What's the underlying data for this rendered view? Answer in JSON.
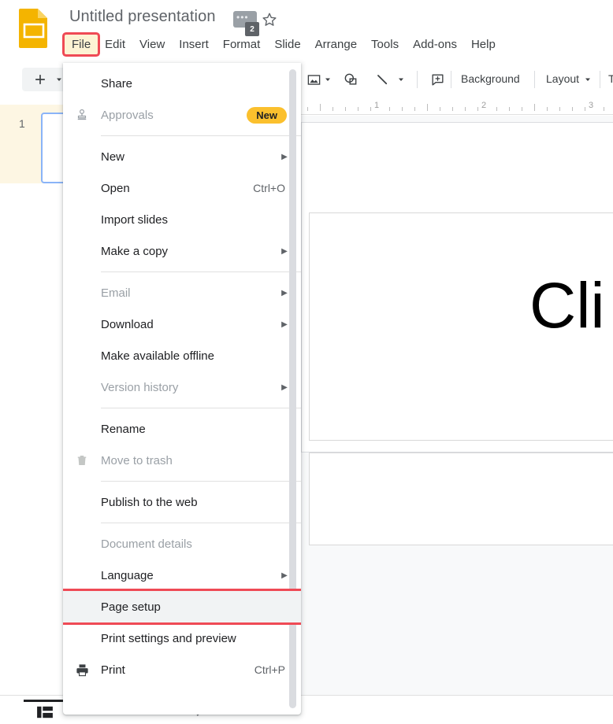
{
  "app": {
    "logo_icon": "google-slides-logo",
    "doc_title": "Untitled presentation",
    "title_chip_dots": "•••",
    "title_badge": "2",
    "star_icon": "star-outline-icon"
  },
  "menubar": {
    "items": [
      {
        "label": "File",
        "active": true
      },
      {
        "label": "Edit",
        "active": false
      },
      {
        "label": "View",
        "active": false
      },
      {
        "label": "Insert",
        "active": false
      },
      {
        "label": "Format",
        "active": false
      },
      {
        "label": "Slide",
        "active": false
      },
      {
        "label": "Arrange",
        "active": false
      },
      {
        "label": "Tools",
        "active": false
      },
      {
        "label": "Add-ons",
        "active": false
      },
      {
        "label": "Help",
        "active": false
      }
    ]
  },
  "toolbar": {
    "new_slide_icon": "plus-icon",
    "new_slide_caret_icon": "chevron-down-icon",
    "image_icon": "image-icon",
    "image_caret_icon": "chevron-down-icon",
    "shape_icon": "shape-icon",
    "line_icon": "line-icon",
    "line_caret_icon": "chevron-down-icon",
    "comment_icon": "add-comment-icon",
    "background_label": "Background",
    "layout_label": "Layout",
    "layout_caret_icon": "chevron-down-icon",
    "theme_label": "T"
  },
  "ruler": {
    "numbers": [
      "1",
      "2",
      "3"
    ]
  },
  "filmstrip": {
    "slide_number": "1"
  },
  "canvas": {
    "title_placeholder_text": "Cli",
    "title_placeholder_name": "title-placeholder",
    "subtitle_placeholder_name": "subtitle-placeholder"
  },
  "bottombar": {
    "layout_icon": "layout-view-icon",
    "grid_icon": "grid-view-icon",
    "pen_icon": "pen-icon"
  },
  "file_menu": {
    "scrollbar_name": "menu-scrollbar",
    "items": [
      {
        "type": "item",
        "label": "Share",
        "icon": "",
        "accel": "",
        "arrow": false,
        "disabled": false,
        "badge": "",
        "highlight": false
      },
      {
        "type": "item",
        "label": "Approvals",
        "icon": "stamp-icon",
        "accel": "",
        "arrow": false,
        "disabled": true,
        "badge": "New",
        "highlight": false
      },
      {
        "type": "sep"
      },
      {
        "type": "item",
        "label": "New",
        "icon": "",
        "accel": "",
        "arrow": true,
        "disabled": false,
        "badge": "",
        "highlight": false
      },
      {
        "type": "item",
        "label": "Open",
        "icon": "",
        "accel": "Ctrl+O",
        "arrow": false,
        "disabled": false,
        "badge": "",
        "highlight": false
      },
      {
        "type": "item",
        "label": "Import slides",
        "icon": "",
        "accel": "",
        "arrow": false,
        "disabled": false,
        "badge": "",
        "highlight": false
      },
      {
        "type": "item",
        "label": "Make a copy",
        "icon": "",
        "accel": "",
        "arrow": true,
        "disabled": false,
        "badge": "",
        "highlight": false
      },
      {
        "type": "sep"
      },
      {
        "type": "item",
        "label": "Email",
        "icon": "",
        "accel": "",
        "arrow": true,
        "disabled": true,
        "badge": "",
        "highlight": false
      },
      {
        "type": "item",
        "label": "Download",
        "icon": "",
        "accel": "",
        "arrow": true,
        "disabled": false,
        "badge": "",
        "highlight": false
      },
      {
        "type": "item",
        "label": "Make available offline",
        "icon": "",
        "accel": "",
        "arrow": false,
        "disabled": false,
        "badge": "",
        "highlight": false
      },
      {
        "type": "item",
        "label": "Version history",
        "icon": "",
        "accel": "",
        "arrow": true,
        "disabled": true,
        "badge": "",
        "highlight": false
      },
      {
        "type": "sep"
      },
      {
        "type": "item",
        "label": "Rename",
        "icon": "",
        "accel": "",
        "arrow": false,
        "disabled": false,
        "badge": "",
        "highlight": false
      },
      {
        "type": "item",
        "label": "Move to trash",
        "icon": "trash-icon",
        "accel": "",
        "arrow": false,
        "disabled": true,
        "badge": "",
        "highlight": false
      },
      {
        "type": "sep"
      },
      {
        "type": "item",
        "label": "Publish to the web",
        "icon": "",
        "accel": "",
        "arrow": false,
        "disabled": false,
        "badge": "",
        "highlight": false
      },
      {
        "type": "sep"
      },
      {
        "type": "item",
        "label": "Document details",
        "icon": "",
        "accel": "",
        "arrow": false,
        "disabled": true,
        "badge": "",
        "highlight": false
      },
      {
        "type": "item",
        "label": "Language",
        "icon": "",
        "accel": "",
        "arrow": true,
        "disabled": false,
        "badge": "",
        "highlight": false
      },
      {
        "type": "item",
        "label": "Page setup",
        "icon": "",
        "accel": "",
        "arrow": false,
        "disabled": false,
        "badge": "",
        "highlight": true
      },
      {
        "type": "item",
        "label": "Print settings and preview",
        "icon": "",
        "accel": "",
        "arrow": false,
        "disabled": false,
        "badge": "",
        "highlight": false
      },
      {
        "type": "item",
        "label": "Print",
        "icon": "printer-icon",
        "accel": "Ctrl+P",
        "arrow": false,
        "disabled": false,
        "badge": "",
        "highlight": false
      }
    ]
  },
  "colors": {
    "brand_yellow": "#F4B400",
    "highlight_red": "#EF4A55",
    "menu_active_bg": "#FDF3D4",
    "badge_yellow": "#FBC02D",
    "text_primary": "#202124",
    "text_disabled": "#9AA0A6"
  }
}
